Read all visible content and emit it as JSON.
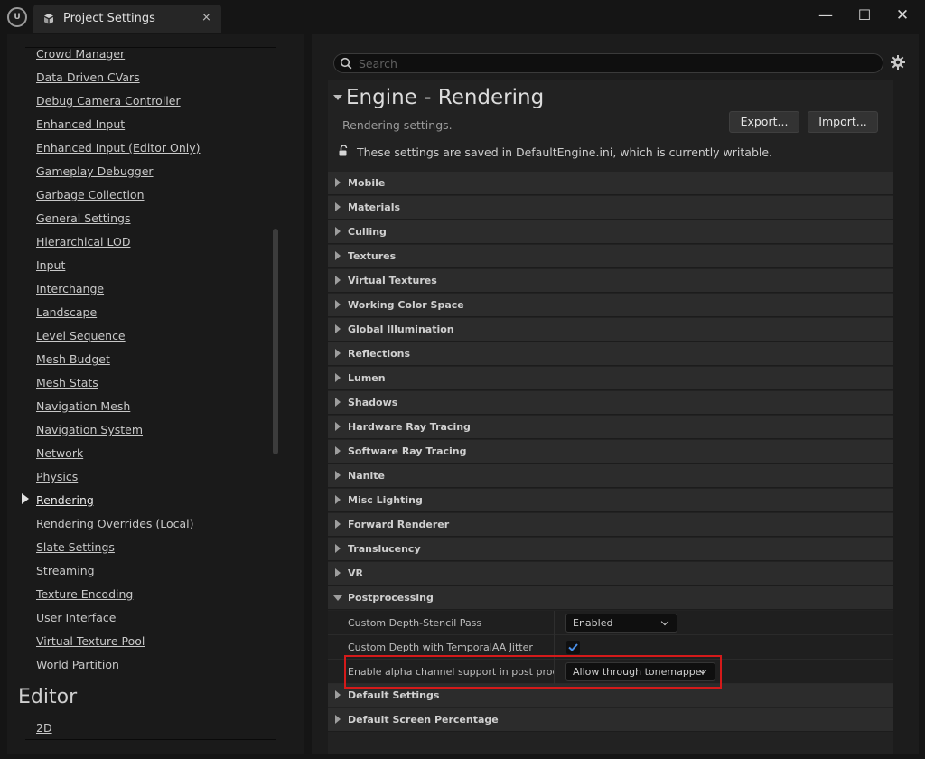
{
  "window": {
    "tab_title": "Project Settings",
    "close_glyph": "×",
    "minimize_glyph": "—",
    "maximize_glyph": "☐",
    "window_close_glyph": "✕",
    "logo_text": "U"
  },
  "sidebar": {
    "items": [
      {
        "label": "Crowd Manager"
      },
      {
        "label": "Data Driven CVars"
      },
      {
        "label": "Debug Camera Controller"
      },
      {
        "label": "Enhanced Input"
      },
      {
        "label": "Enhanced Input (Editor Only)"
      },
      {
        "label": "Gameplay Debugger"
      },
      {
        "label": "Garbage Collection"
      },
      {
        "label": "General Settings"
      },
      {
        "label": "Hierarchical LOD"
      },
      {
        "label": "Input"
      },
      {
        "label": "Interchange"
      },
      {
        "label": "Landscape"
      },
      {
        "label": "Level Sequence"
      },
      {
        "label": "Mesh Budget"
      },
      {
        "label": "Mesh Stats"
      },
      {
        "label": "Navigation Mesh"
      },
      {
        "label": "Navigation System"
      },
      {
        "label": "Network"
      },
      {
        "label": "Physics"
      },
      {
        "label": "Rendering"
      },
      {
        "label": "Rendering Overrides (Local)"
      },
      {
        "label": "Slate Settings"
      },
      {
        "label": "Streaming"
      },
      {
        "label": "Texture Encoding"
      },
      {
        "label": "User Interface"
      },
      {
        "label": "Virtual Texture Pool"
      },
      {
        "label": "World Partition"
      }
    ],
    "active_item": "Rendering",
    "section_editor": "Editor",
    "editor_items": [
      {
        "label": "2D"
      }
    ]
  },
  "search": {
    "placeholder": "Search",
    "value": ""
  },
  "header": {
    "title": "Engine - Rendering",
    "subtitle": "Rendering settings.",
    "export_label": "Export...",
    "import_label": "Import...",
    "save_note": "These settings are saved in DefaultEngine.ini, which is currently writable."
  },
  "categories": [
    {
      "label": "Mobile",
      "expanded": false
    },
    {
      "label": "Materials",
      "expanded": false
    },
    {
      "label": "Culling",
      "expanded": false
    },
    {
      "label": "Textures",
      "expanded": false
    },
    {
      "label": "Virtual Textures",
      "expanded": false
    },
    {
      "label": "Working Color Space",
      "expanded": false
    },
    {
      "label": "Global Illumination",
      "expanded": false
    },
    {
      "label": "Reflections",
      "expanded": false
    },
    {
      "label": "Lumen",
      "expanded": false
    },
    {
      "label": "Shadows",
      "expanded": false
    },
    {
      "label": "Hardware Ray Tracing",
      "expanded": false
    },
    {
      "label": "Software Ray Tracing",
      "expanded": false
    },
    {
      "label": "Nanite",
      "expanded": false
    },
    {
      "label": "Misc Lighting",
      "expanded": false
    },
    {
      "label": "Forward Renderer",
      "expanded": false
    },
    {
      "label": "Translucency",
      "expanded": false
    },
    {
      "label": "VR",
      "expanded": false
    },
    {
      "label": "Postprocessing",
      "expanded": true
    }
  ],
  "postprocessing": {
    "custom_depth_label": "Custom Depth-Stencil Pass",
    "custom_depth_value": "Enabled",
    "taa_jitter_label": "Custom Depth with TemporalAA Jitter",
    "taa_jitter_checked": true,
    "alpha_label": "Enable alpha channel support in post proce...",
    "alpha_value": "Allow through tonemapper"
  },
  "after_categories": [
    {
      "label": "Default Settings"
    },
    {
      "label": "Default Screen Percentage"
    }
  ],
  "colors": {
    "highlight": "#d41a1a",
    "checkmark": "#4a8fe7"
  }
}
